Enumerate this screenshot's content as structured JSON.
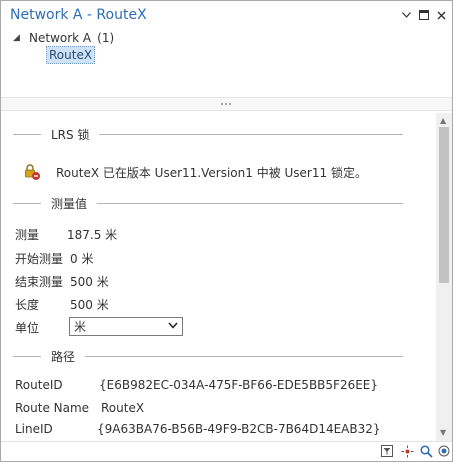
{
  "window": {
    "title": "Network A - RouteX"
  },
  "titlebar": {
    "menu_icon": "chevron-down-icon",
    "maximize_icon": "maximize-icon",
    "close_icon": "close-icon"
  },
  "tree": {
    "root_label": "Network A",
    "root_count": "(1)",
    "child_label": "RouteX"
  },
  "sections": {
    "lrs_lock": "LRS 锁",
    "measures": "测量值",
    "route": "路径"
  },
  "lock": {
    "message": "RouteX 已在版本 User11.Version1 中被 User11 锁定。"
  },
  "measures": {
    "measure_label": "测量",
    "measure_value": "187.5 米",
    "from_label": "开始测量",
    "from_value": "0 米",
    "to_label": "结束测量",
    "to_value": "500 米",
    "length_label": "长度",
    "length_value": "500 米",
    "units_label": "单位",
    "units_value": "米"
  },
  "route": {
    "routeid_label": "RouteID",
    "routeid_value": "{E6B982EC-034A-475F-BF66-EDE5BB5F26EE}",
    "routename_label": "Route Name",
    "routename_value": "RouteX",
    "lineid_label": "LineID",
    "lineid_value": "{9A63BA76-B56B-49F9-B2CB-7B64D14EAB32}"
  },
  "colors": {
    "title": "#2f6db5",
    "selection": "#cfe3f6",
    "lock_accent": "#d9a21b",
    "lock_badge": "#c0392b"
  }
}
